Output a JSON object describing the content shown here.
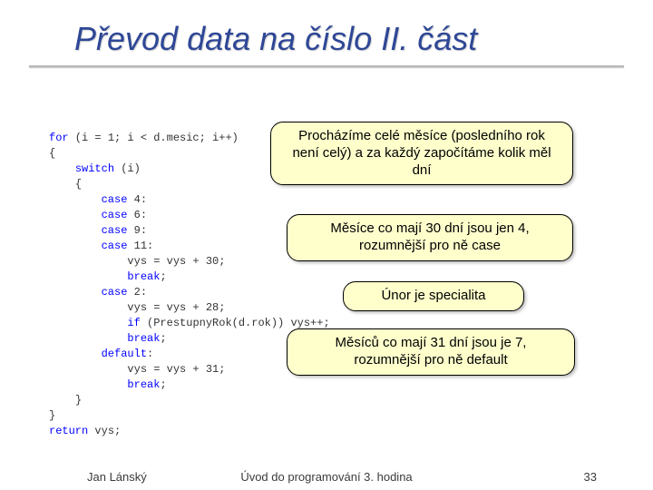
{
  "title": "Převod data na číslo II. část",
  "code": {
    "l1a": "for",
    "l1b": " (i = 1; i < d.mesic; i++)",
    "l2": "{",
    "l3a": "switch",
    "l3b": " (i)",
    "l4": "{",
    "l5a": "case",
    "l5b": " 4:",
    "l6a": "case",
    "l6b": " 6:",
    "l7a": "case",
    "l7b": " 9:",
    "l8a": "case",
    "l8b": " 11:",
    "l9": "vys = vys + 30;",
    "l10": "break",
    "sc": ";",
    "l11a": "case",
    "l11b": " 2:",
    "l12": "vys = vys + 28;",
    "l13a": "if",
    "l13b": " (PrestupnyRok(d.rok)) vys++;",
    "l14": "break",
    "l15": "default",
    "l15b": ":",
    "l16": "vys = vys + 31;",
    "l17": "break",
    "l18": "}",
    "l19": "}",
    "l20a": "return",
    "l20b": " vys;"
  },
  "callouts": {
    "c1": "Procházíme celé měsíce (posledního rok není celý) a za každý započítáme kolik měl dní",
    "c2": "Měsíce co mají 30 dní jsou jen 4, rozumnější pro ně case",
    "c3": "Únor je specialita",
    "c4": "Měsíců co mají 31 dní jsou je 7, rozumnější pro ně default"
  },
  "footer": {
    "left": "Jan Lánský",
    "center": "Úvod do programování 3. hodina",
    "right": "33"
  }
}
